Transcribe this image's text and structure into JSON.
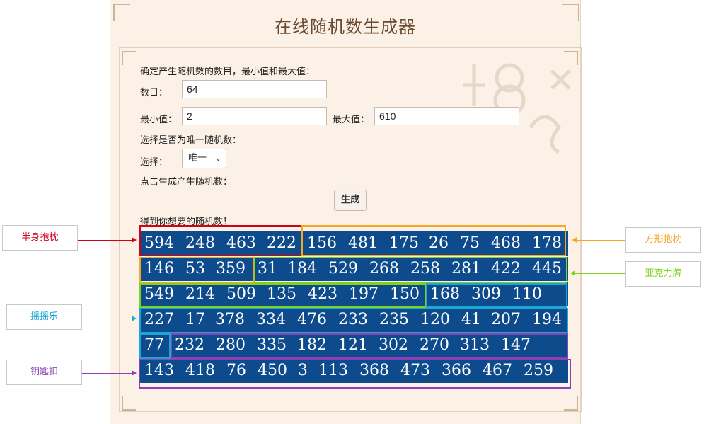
{
  "page_title": "在线随机数生成器",
  "intro": "确定产生随机数的数目，最小值和最大值：",
  "count": {
    "label": "数目：",
    "value": "64"
  },
  "min": {
    "label": "最小值：",
    "value": "2"
  },
  "max": {
    "label": "最大值：",
    "value": "610"
  },
  "unique_prompt": "选择是否为唯一随机数：",
  "select": {
    "label": "选择：",
    "value": "唯一"
  },
  "generate_prompt": "点击生成产生随机数：",
  "generate_button": "生成",
  "result_heading": "得到你想要的随机数！",
  "results": [
    [
      "594",
      "248",
      "463",
      "222",
      "156",
      "481",
      "175",
      "26",
      "75",
      "468",
      "178"
    ],
    [
      "146",
      "53",
      "359",
      "31",
      "184",
      "529",
      "268",
      "258",
      "281",
      "422",
      "445"
    ],
    [
      "549",
      "214",
      "509",
      "135",
      "423",
      "197",
      "150",
      "168",
      "309",
      "110"
    ],
    [
      "227",
      "17",
      "378",
      "334",
      "476",
      "233",
      "235",
      "120",
      "41",
      "207",
      "194"
    ],
    [
      "77",
      "232",
      "280",
      "335",
      "182",
      "121",
      "302",
      "270",
      "313",
      "147"
    ],
    [
      "143",
      "418",
      "76",
      "450",
      "3",
      "113",
      "368",
      "473",
      "366",
      "467",
      "259"
    ]
  ],
  "annotations": [
    {
      "label": "半身抱枕",
      "color": "#d0021b"
    },
    {
      "label": "方形抱枕",
      "color": "#f5a623"
    },
    {
      "label": "亚克力牌",
      "color": "#7ed321"
    },
    {
      "label": "摇摇乐",
      "color": "#1aa7d6"
    },
    {
      "label": "钥匙扣",
      "color": "#8e3fb5"
    }
  ]
}
